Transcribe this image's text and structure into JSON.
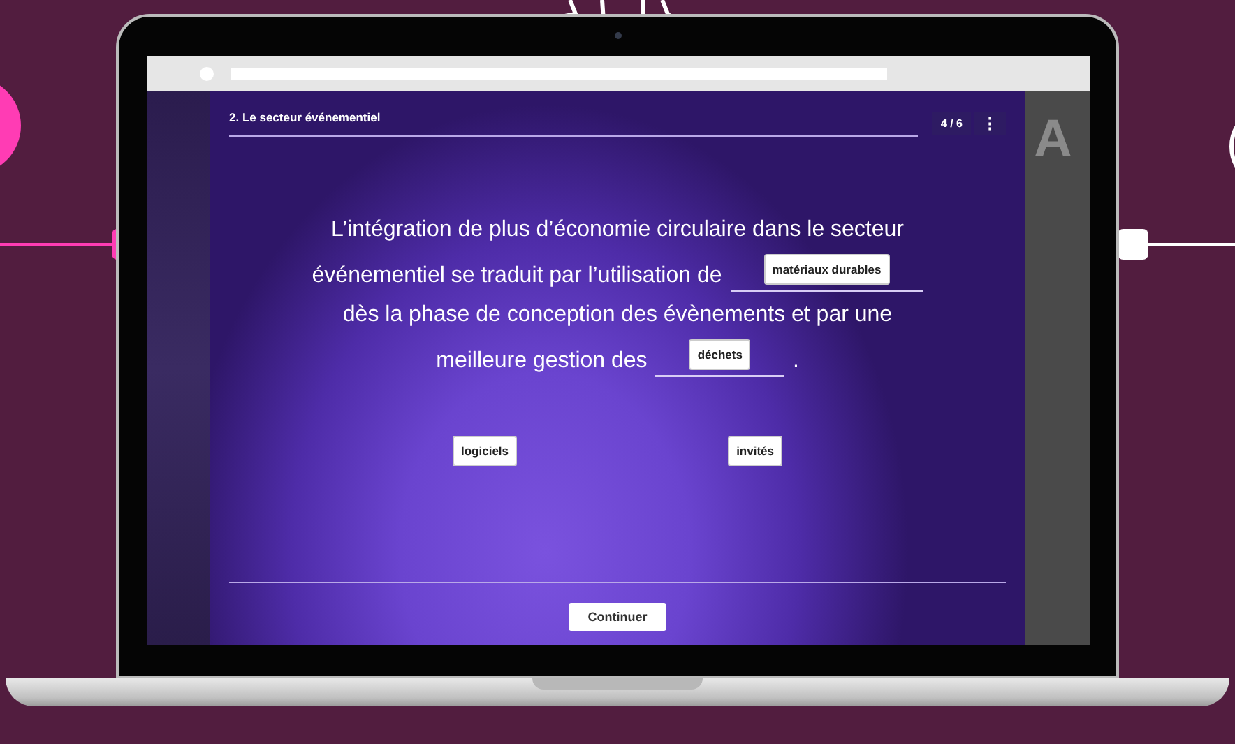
{
  "header": {
    "title": "2. Le secteur événementiel",
    "progress": "4 / 6",
    "menu_icon": "⋮"
  },
  "side_panel": {
    "text": "A"
  },
  "question": {
    "lines": [
      [
        {
          "kind": "text",
          "text": "L’intégration de plus d’économie circulaire dans le secteur"
        }
      ],
      [
        {
          "kind": "text",
          "text": "événementiel se traduit par l’utilisation de"
        },
        {
          "kind": "blank",
          "answer": "matériaux durables"
        }
      ],
      [
        {
          "kind": "text",
          "text": "dès la phase de conception des évènements et par une"
        }
      ],
      [
        {
          "kind": "text",
          "text": "meilleure gestion des"
        },
        {
          "kind": "blank",
          "answer": "déchets"
        },
        {
          "kind": "text",
          "text": "."
        }
      ]
    ]
  },
  "choices": [
    {
      "label": "logiciels"
    },
    {
      "label": "invités"
    }
  ],
  "footer": {
    "button": "Continuer"
  }
}
